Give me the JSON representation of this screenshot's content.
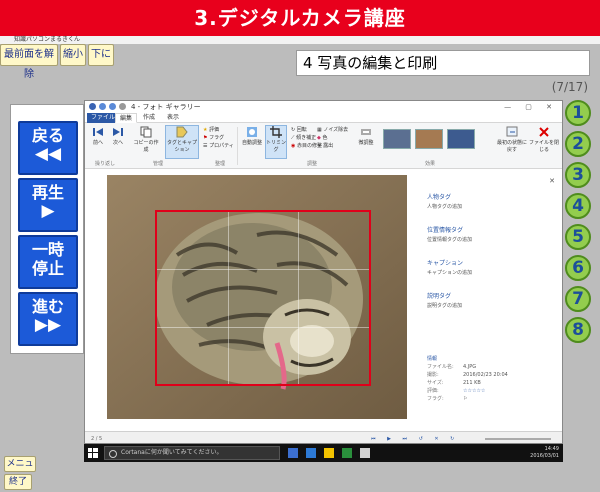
{
  "header": {
    "title": "3.デジタルカメラ講座",
    "window_caption": "知識パソコンまるきくん"
  },
  "controls": {
    "top_button": "最前面を解除",
    "minimize": "縮小",
    "down": "下に"
  },
  "lesson": {
    "title": "4 写真の編集と印刷",
    "page_counter": "(7/17)"
  },
  "player": {
    "back": {
      "label": "戻る",
      "glyph": "◀◀"
    },
    "play": {
      "label": "再生",
      "glyph": "▶"
    },
    "pause": {
      "label_line1": "一時",
      "label_line2": "停止"
    },
    "forward": {
      "label": "進む",
      "glyph": "▶▶"
    }
  },
  "chapters": [
    "1",
    "2",
    "3",
    "4",
    "5",
    "6",
    "7",
    "8"
  ],
  "bottom": {
    "menu": "メニュー",
    "exit": "終了"
  },
  "app": {
    "title": "4 - フォト ギャラリー",
    "tabs": [
      "ファイル",
      "編集",
      "作成",
      "表示"
    ],
    "groups": [
      "操り返し",
      "管理",
      "整理",
      "調整",
      "効果"
    ],
    "ribbon_items": {
      "prev": "前へ",
      "next": "次へ",
      "copy": "コピーの作成",
      "tag": "タグとキャプション",
      "rating": "評価",
      "flag": "フラグ",
      "property": "プロパティ",
      "auto_adjust": "自動調整",
      "crop": "トリミング",
      "rotate": "回転",
      "straighten": "傾き補正",
      "red_eye": "赤目の修整",
      "noise": "ノイズ除去",
      "color": "色",
      "exposure": "露出",
      "fine_tune": "微調整",
      "revert": "最初の状態に戻す",
      "close_file": "ファイルを閉じる"
    },
    "properties": [
      {
        "head": "人物タグ",
        "value": "人物タグの追加"
      },
      {
        "head": "位置情報タグ",
        "value": "位置情報タグの追加"
      },
      {
        "head": "キャプション",
        "value": "キャプションの追加"
      },
      {
        "head": "説明タグ",
        "value": "説明タグの追加"
      }
    ],
    "info_title": "情報",
    "info": [
      {
        "k": "ファイル名:",
        "v": "4.JPG"
      },
      {
        "k": "撮影:",
        "v": "2016/02/23 20:04"
      },
      {
        "k": "サイズ:",
        "v": "211 KB"
      },
      {
        "k": "評価:",
        "v": "☆☆☆☆☆"
      },
      {
        "k": "フラグ:",
        "v": "⚐"
      }
    ],
    "status": "2 / 5"
  },
  "taskbar": {
    "search": "Cortanaに何か聞いてみてください。",
    "time": "14:49",
    "date": "2016/03/01"
  }
}
